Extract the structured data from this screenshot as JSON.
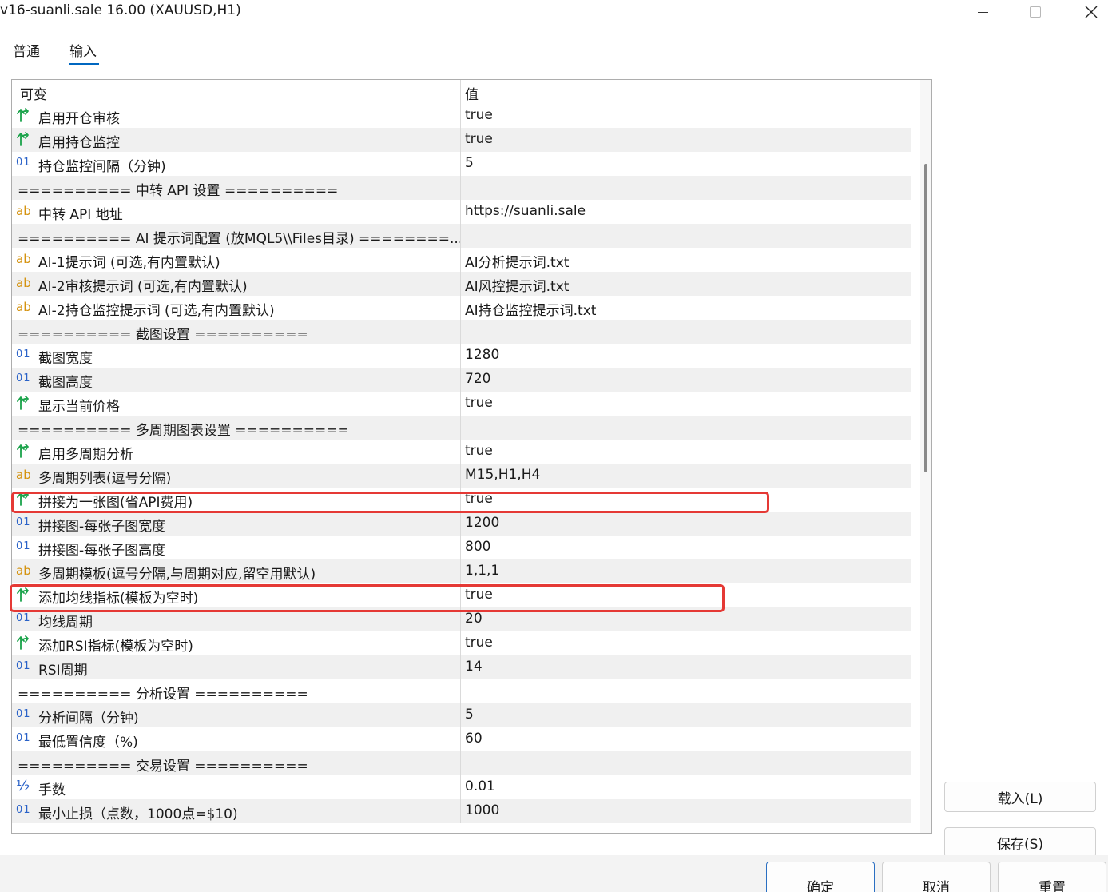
{
  "window": {
    "title": "v16-suanli.sale 16.00 (XAUUSD,H1)"
  },
  "tabs": [
    {
      "label": "普通"
    },
    {
      "label": "输入"
    }
  ],
  "grid": {
    "header": {
      "name": "可变",
      "value": "值"
    },
    "rows": [
      {
        "type": "bool",
        "name": "启用开仓审核",
        "value": "true"
      },
      {
        "type": "bool",
        "name": "启用持仓监控",
        "value": "true"
      },
      {
        "type": "int",
        "name": "持仓监控间隔（分钟)",
        "value": "5"
      },
      {
        "type": "sep",
        "name": "========== 中转 API 设置 ==========",
        "value": ""
      },
      {
        "type": "string",
        "name": "中转 API 地址",
        "value": "https://suanli.sale"
      },
      {
        "type": "sep",
        "name": "========== AI 提示词配置 (放MQL5\\\\Files目录) ========...",
        "value": ""
      },
      {
        "type": "string",
        "name": "AI-1提示词 (可选,有内置默认)",
        "value": "AI分析提示词.txt"
      },
      {
        "type": "string",
        "name": "AI-2审核提示词 (可选,有内置默认)",
        "value": "AI风控提示词.txt"
      },
      {
        "type": "string",
        "name": "AI-2持仓监控提示词 (可选,有内置默认)",
        "value": "AI持仓监控提示词.txt"
      },
      {
        "type": "sep",
        "name": "========== 截图设置 ==========",
        "value": ""
      },
      {
        "type": "int",
        "name": "截图宽度",
        "value": "1280"
      },
      {
        "type": "int",
        "name": "截图高度",
        "value": "720"
      },
      {
        "type": "bool",
        "name": "显示当前价格",
        "value": "true"
      },
      {
        "type": "sep",
        "name": "========== 多周期图表设置 ==========",
        "value": ""
      },
      {
        "type": "bool",
        "name": "启用多周期分析",
        "value": "true"
      },
      {
        "type": "string",
        "name": "多周期列表(逗号分隔)",
        "value": "M15,H1,H4"
      },
      {
        "type": "bool",
        "name": "拼接为一张图(省API费用)",
        "value": "true"
      },
      {
        "type": "int",
        "name": "拼接图-每张子图宽度",
        "value": "1200"
      },
      {
        "type": "int",
        "name": "拼接图-每张子图高度",
        "value": "800"
      },
      {
        "type": "string",
        "name": "多周期模板(逗号分隔,与周期对应,留空用默认)",
        "value": "1,1,1"
      },
      {
        "type": "bool",
        "name": "添加均线指标(模板为空时)",
        "value": "true"
      },
      {
        "type": "int",
        "name": "均线周期",
        "value": "20"
      },
      {
        "type": "bool",
        "name": "添加RSI指标(模板为空时)",
        "value": "true"
      },
      {
        "type": "int",
        "name": "RSI周期",
        "value": "14"
      },
      {
        "type": "sep",
        "name": "========== 分析设置 ==========",
        "value": ""
      },
      {
        "type": "int",
        "name": "分析间隔（分钟)",
        "value": "5"
      },
      {
        "type": "int",
        "name": "最低置信度（%)",
        "value": "60"
      },
      {
        "type": "sep",
        "name": "========== 交易设置 ==========",
        "value": ""
      },
      {
        "type": "double",
        "name": "手数",
        "value": "0.01"
      },
      {
        "type": "int",
        "name": "最小止损（点数，1000点=$10)",
        "value": "1000"
      }
    ]
  },
  "icons": {
    "bool": "green-arrow-icon",
    "int": "01",
    "string": "ab",
    "double": "½"
  },
  "side_buttons": {
    "load": "载入(L)",
    "save": "保存(S)"
  },
  "footer_buttons": {
    "ok": "确定",
    "cancel": "取消",
    "reset": "重置"
  },
  "colors": {
    "highlight": "#e53935",
    "accent": "#0067c0",
    "bool_icon": "#1aa34a",
    "int_icon": "#2a62c8",
    "string_icon": "#d4910c"
  }
}
